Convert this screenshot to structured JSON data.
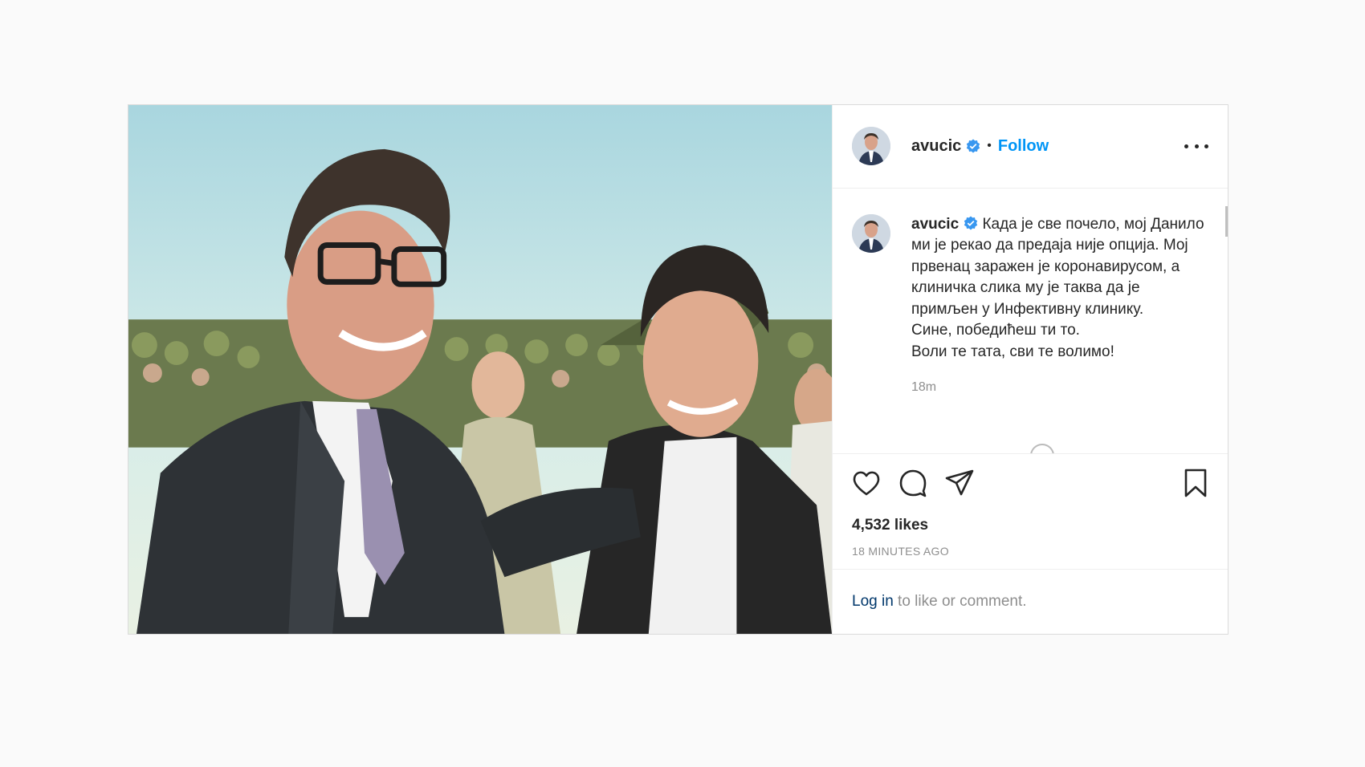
{
  "post": {
    "username": "avucic",
    "follow_label": "Follow",
    "separator": "•",
    "caption": "Када је све почело, мој Данило ми је рекао да предаја није опција. Мој првенац заражен је коронавирусом, а клиничка слика му је таква да је примљен у Инфективну клинику.\nСине, победићеш ти то.\nВоли те тата, сви те волимо!",
    "caption_age": "18m",
    "likes": "4,532 likes",
    "posted_ago": "18 MINUTES AGO",
    "login_link": "Log in",
    "login_suffix": " to like or comment."
  },
  "icons": {
    "verified": "verified-badge-icon",
    "more": "more-options-icon",
    "like": "heart-icon",
    "comment": "comment-icon",
    "share": "paper-plane-icon",
    "save": "bookmark-icon"
  },
  "colors": {
    "link_blue": "#0095f6",
    "login_blue": "#00376b",
    "muted": "#8e8e8e",
    "border": "#dbdbdb"
  }
}
